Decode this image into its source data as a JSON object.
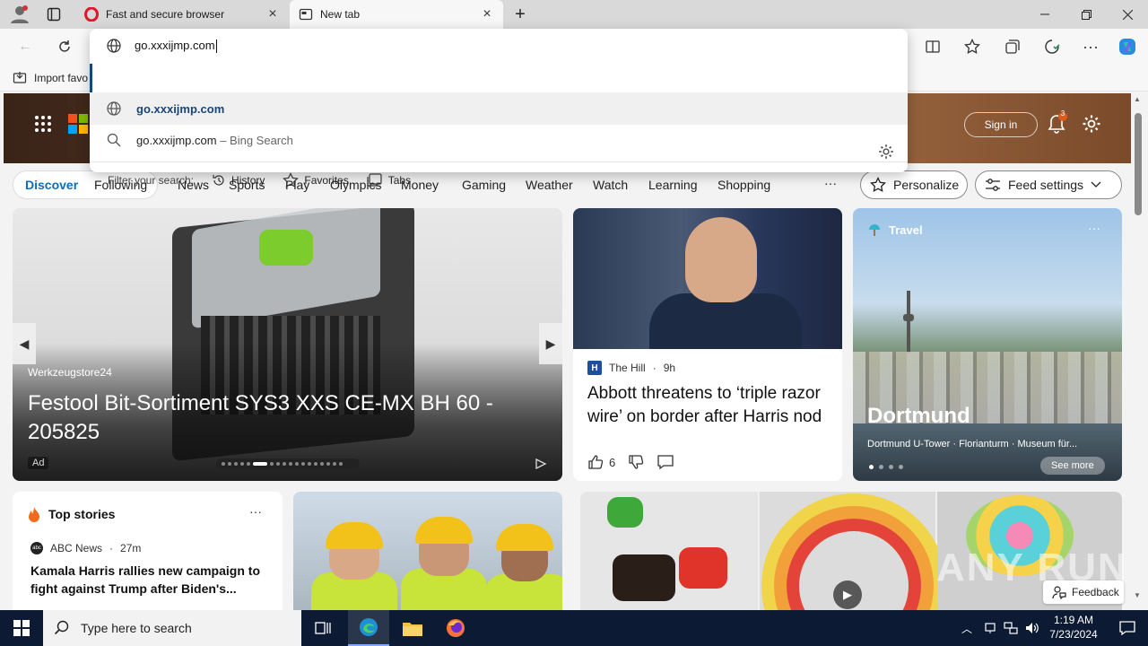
{
  "tabs": {
    "inactive_label": "Fast and secure browser",
    "active_label": "New tab"
  },
  "favorites_bar": {
    "import_label": "Import favo"
  },
  "address": {
    "typed_value": "go.xxxijmp.com",
    "suggestion_url_prefix": "go.",
    "suggestion_url_rest": "xxxijmp.com",
    "bing_query": "go.xxxijmp.com",
    "bing_suffix": "– Bing Search",
    "filter_label": "Filter your search:",
    "filters": [
      "History",
      "Favorites",
      "Tabs"
    ]
  },
  "header": {
    "sign_in": "Sign in",
    "notification_count": "3"
  },
  "nav": {
    "discover": "Discover",
    "following": "Following",
    "items": [
      "News",
      "Sports",
      "Play",
      "Olympics",
      "Money",
      "Gaming",
      "Weather",
      "Watch",
      "Learning",
      "Shopping"
    ],
    "more": "···",
    "personalize": "Personalize",
    "feed_settings": "Feed settings"
  },
  "ad_card": {
    "source": "Werkzeugstore24",
    "title": "Festool Bit-Sortiment SYS3 XXS CE-MX BH 60 - 205825",
    "tag": "Ad"
  },
  "news_card": {
    "source": "The Hill",
    "age": "9h",
    "title": "Abbott threatens to ‘triple razor wire’ on border after Harris nod",
    "likes": "6"
  },
  "travel_card": {
    "label": "Travel",
    "title": "Dortmund",
    "subtitle": "Dortmund U-Tower · Florianturm · Museum für...",
    "see_more": "See more"
  },
  "top_stories": {
    "header": "Top stories",
    "source": "ABC News",
    "age": "27m",
    "title": "Kamala Harris rallies new campaign to fight against Trump after Biden's..."
  },
  "feedback": "Feedback",
  "watermark": "ANY RUN",
  "taskbar": {
    "search_placeholder": "Type here to search",
    "time": "1:19 AM",
    "date": "7/23/2024"
  },
  "colors": {
    "accent": "#0f6cbd",
    "taskbar": "#0c1b33",
    "suggestion_text": "#1a4577"
  }
}
